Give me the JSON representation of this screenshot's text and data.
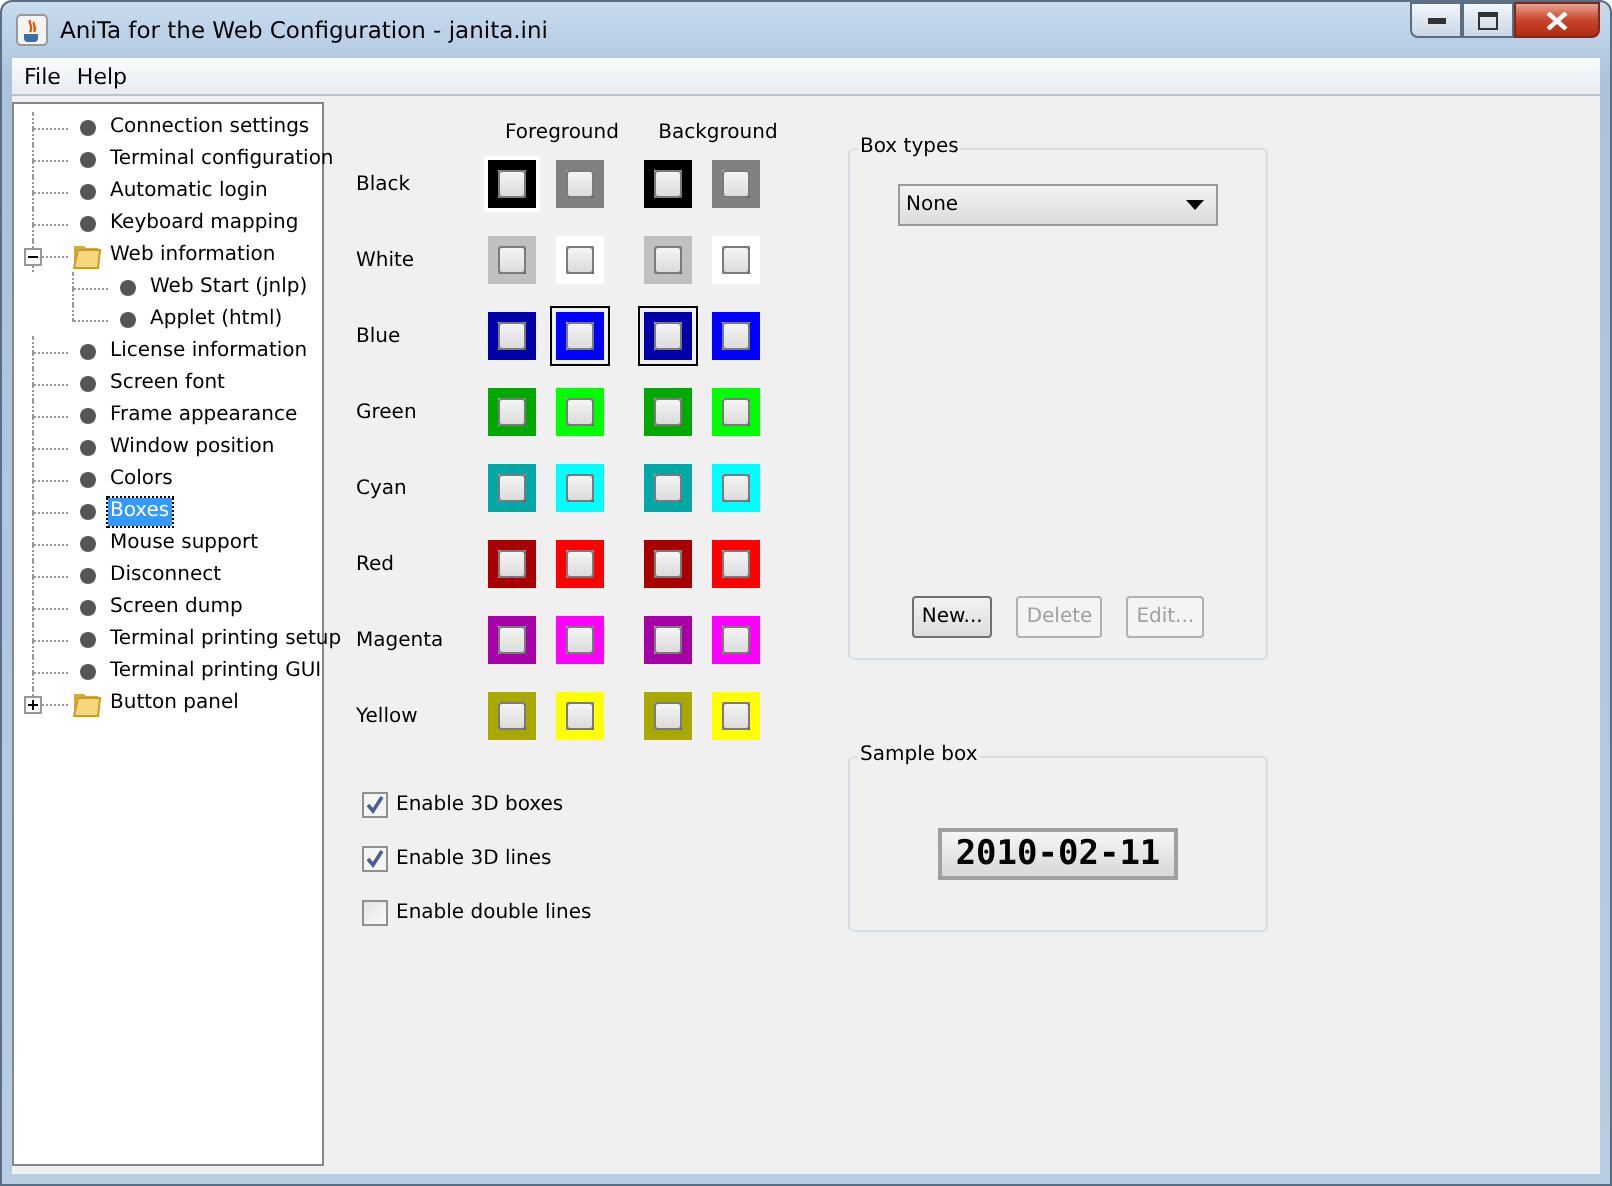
{
  "window": {
    "title": "AniTa for the Web Configuration - janita.ini"
  },
  "menu": [
    "File",
    "Help"
  ],
  "tree": [
    {
      "label": "Connection settings",
      "kind": "leaf",
      "selected": false
    },
    {
      "label": "Terminal configuration",
      "kind": "leaf",
      "selected": false
    },
    {
      "label": "Automatic login",
      "kind": "leaf",
      "selected": false
    },
    {
      "label": "Keyboard mapping",
      "kind": "leaf",
      "selected": false
    },
    {
      "label": "Web information",
      "kind": "folder",
      "expanded": true,
      "selected": false,
      "children": [
        {
          "label": "Web Start (jnlp)",
          "kind": "leaf",
          "selected": false
        },
        {
          "label": "Applet (html)",
          "kind": "leaf",
          "selected": false
        }
      ]
    },
    {
      "label": "License information",
      "kind": "leaf",
      "selected": false
    },
    {
      "label": "Screen font",
      "kind": "leaf",
      "selected": false
    },
    {
      "label": "Frame appearance",
      "kind": "leaf",
      "selected": false
    },
    {
      "label": "Window position",
      "kind": "leaf",
      "selected": false
    },
    {
      "label": "Colors",
      "kind": "leaf",
      "selected": false
    },
    {
      "label": "Boxes",
      "kind": "leaf",
      "selected": true
    },
    {
      "label": "Mouse support",
      "kind": "leaf",
      "selected": false
    },
    {
      "label": "Disconnect",
      "kind": "leaf",
      "selected": false
    },
    {
      "label": "Screen dump",
      "kind": "leaf",
      "selected": false
    },
    {
      "label": "Terminal printing setup",
      "kind": "leaf",
      "selected": false
    },
    {
      "label": "Terminal printing GUI",
      "kind": "leaf",
      "selected": false
    },
    {
      "label": "Button panel",
      "kind": "folder",
      "expanded": false,
      "selected": false
    }
  ],
  "colors": {
    "headers": [
      "Foreground",
      "Background"
    ],
    "rows": [
      {
        "label": "Black",
        "foreground": [
          {
            "color": "#000000",
            "selected": false,
            "focused": true
          },
          {
            "color": "#808080",
            "selected": false,
            "focused": false
          }
        ],
        "background": [
          {
            "color": "#000000",
            "selected": false,
            "focused": false
          },
          {
            "color": "#808080",
            "selected": false,
            "focused": false
          }
        ]
      },
      {
        "label": "White",
        "foreground": [
          {
            "color": "#c0c0c0",
            "selected": false,
            "focused": false
          },
          {
            "color": "#ffffff",
            "selected": false,
            "focused": false
          }
        ],
        "background": [
          {
            "color": "#c0c0c0",
            "selected": false,
            "focused": false
          },
          {
            "color": "#ffffff",
            "selected": false,
            "focused": false
          }
        ]
      },
      {
        "label": "Blue",
        "foreground": [
          {
            "color": "#0000a8",
            "selected": false,
            "focused": false
          },
          {
            "color": "#0000ff",
            "selected": true,
            "focused": false
          }
        ],
        "background": [
          {
            "color": "#0000a8",
            "selected": true,
            "focused": false
          },
          {
            "color": "#0000ff",
            "selected": false,
            "focused": false
          }
        ]
      },
      {
        "label": "Green",
        "foreground": [
          {
            "color": "#00a800",
            "selected": false,
            "focused": false
          },
          {
            "color": "#00ff00",
            "selected": false,
            "focused": false
          }
        ],
        "background": [
          {
            "color": "#00a800",
            "selected": false,
            "focused": false
          },
          {
            "color": "#00ff00",
            "selected": false,
            "focused": false
          }
        ]
      },
      {
        "label": "Cyan",
        "foreground": [
          {
            "color": "#00a8a8",
            "selected": false,
            "focused": false
          },
          {
            "color": "#00ffff",
            "selected": false,
            "focused": false
          }
        ],
        "background": [
          {
            "color": "#00a8a8",
            "selected": false,
            "focused": false
          },
          {
            "color": "#00ffff",
            "selected": false,
            "focused": false
          }
        ]
      },
      {
        "label": "Red",
        "foreground": [
          {
            "color": "#a80000",
            "selected": false,
            "focused": false
          },
          {
            "color": "#ff0000",
            "selected": false,
            "focused": false
          }
        ],
        "background": [
          {
            "color": "#a80000",
            "selected": false,
            "focused": false
          },
          {
            "color": "#ff0000",
            "selected": false,
            "focused": false
          }
        ]
      },
      {
        "label": "Magenta",
        "foreground": [
          {
            "color": "#a800a8",
            "selected": false,
            "focused": false
          },
          {
            "color": "#ff00ff",
            "selected": false,
            "focused": false
          }
        ],
        "background": [
          {
            "color": "#a800a8",
            "selected": false,
            "focused": false
          },
          {
            "color": "#ff00ff",
            "selected": false,
            "focused": false
          }
        ]
      },
      {
        "label": "Yellow",
        "foreground": [
          {
            "color": "#a8a800",
            "selected": false,
            "focused": false
          },
          {
            "color": "#ffff00",
            "selected": false,
            "focused": false
          }
        ],
        "background": [
          {
            "color": "#a8a800",
            "selected": false,
            "focused": false
          },
          {
            "color": "#ffff00",
            "selected": false,
            "focused": false
          }
        ]
      }
    ]
  },
  "options": [
    {
      "label": "Enable 3D boxes",
      "checked": true
    },
    {
      "label": "Enable 3D lines",
      "checked": true
    },
    {
      "label": "Enable double lines",
      "checked": false
    }
  ],
  "box_types": {
    "title": "Box types",
    "dropdown": "None",
    "buttons": [
      {
        "label": "New...",
        "disabled": false
      },
      {
        "label": "Delete",
        "disabled": true
      },
      {
        "label": "Edit...",
        "disabled": true
      }
    ]
  },
  "sample_box": {
    "title": "Sample box",
    "sample": "2010-02-11"
  }
}
